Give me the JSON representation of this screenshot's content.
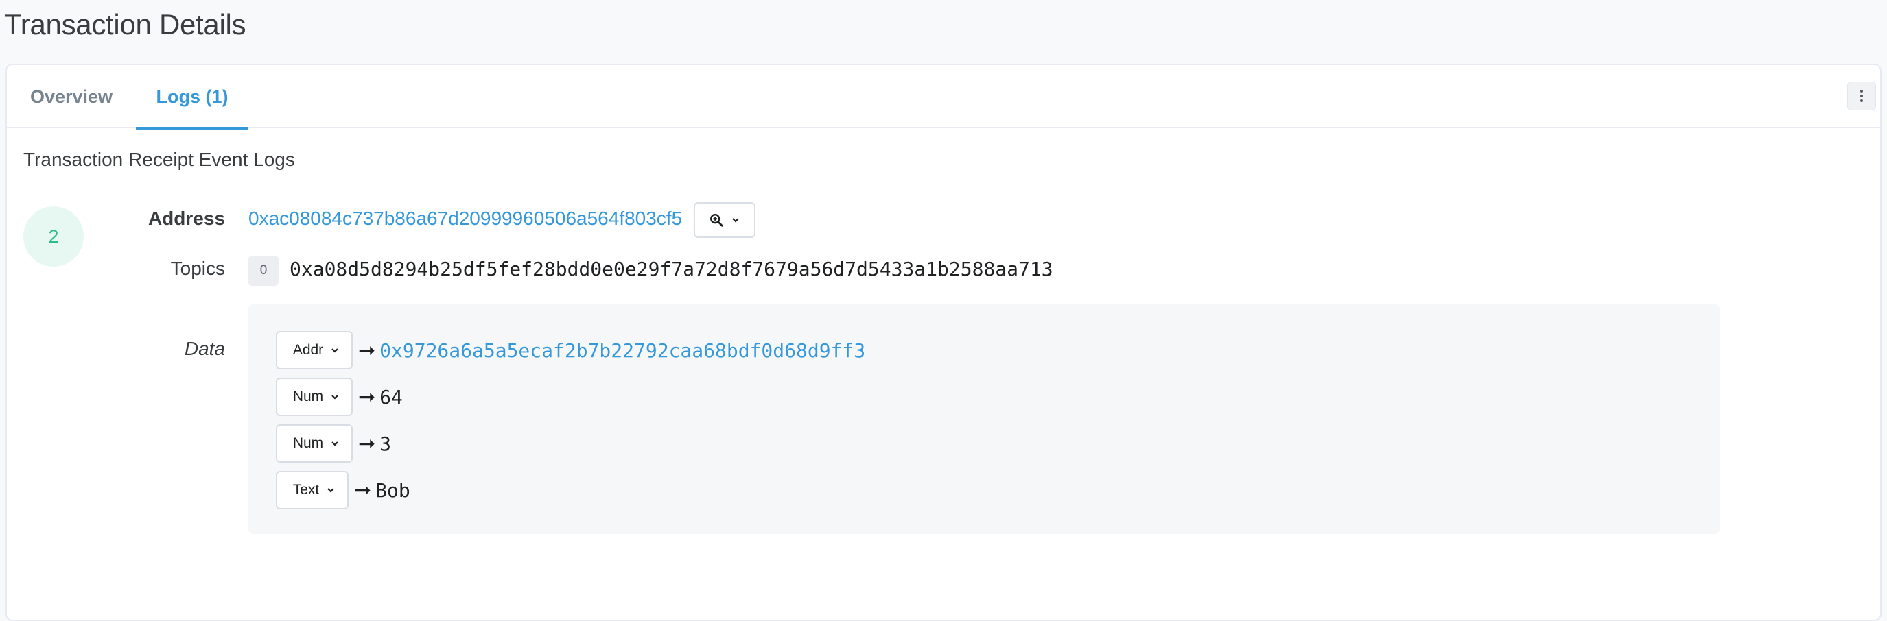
{
  "page": {
    "title": "Transaction Details"
  },
  "tabs": [
    {
      "label": "Overview",
      "active": false
    },
    {
      "label": "Logs (1)",
      "active": true
    }
  ],
  "section": {
    "heading": "Transaction Receipt Event Logs"
  },
  "log": {
    "index": "2",
    "address_label": "Address",
    "address": "0xac08084c737b86a67d20999960506a564f803cf5",
    "topics_label": "Topics",
    "topics": [
      {
        "index": "0",
        "value": "0xa08d5d8294b25df5fef28bdd0e0e29f7a72d8f7679a56d7d5433a1b2588aa713"
      }
    ],
    "data_label": "Data",
    "data": [
      {
        "type": "Addr",
        "value": "0x9726a6a5a5ecaf2b7b22792caa68bdf0d68d9ff3"
      },
      {
        "type": "Num",
        "value": "64"
      },
      {
        "type": "Num",
        "value": "3"
      },
      {
        "type": "Text",
        "value": "Bob"
      }
    ]
  },
  "icons": {
    "more": "more-vertical-icon",
    "zoom": "zoom-in-icon",
    "chevron": "chevron-down-icon",
    "arrow": "long-right-arrow-icon"
  },
  "colors": {
    "accent": "#3498db",
    "index_badge_bg": "#e6f8f1",
    "index_badge_text": "#2fba89",
    "data_box_bg": "#f6f7f9"
  }
}
